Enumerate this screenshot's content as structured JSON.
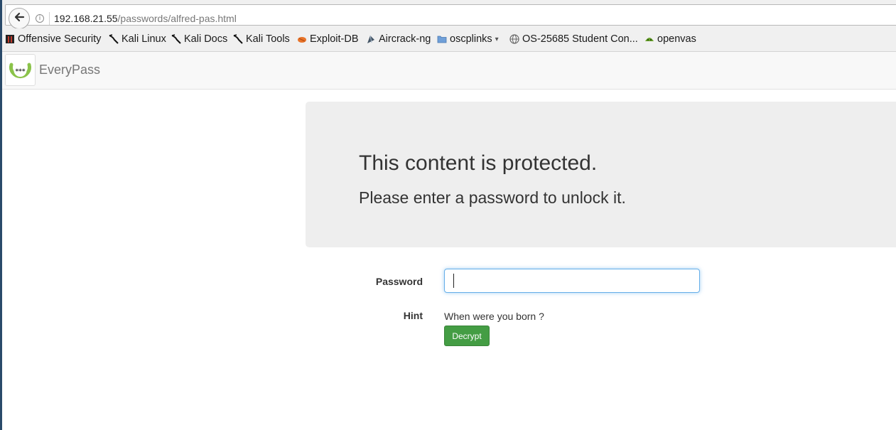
{
  "browser": {
    "url_host": "192.168.21.55",
    "url_path": "/passwords/alfred-pas.html",
    "back_icon": "arrow-left-icon",
    "info_icon": "info-icon"
  },
  "bookmarks": [
    {
      "label": "Offensive Security",
      "icon": "offsec-icon"
    },
    {
      "label": "Kali Linux",
      "icon": "kali-dragon-icon"
    },
    {
      "label": "Kali Docs",
      "icon": "kali-dragon-icon"
    },
    {
      "label": "Kali Tools",
      "icon": "kali-dragon-icon"
    },
    {
      "label": "Exploit-DB",
      "icon": "exploitdb-icon"
    },
    {
      "label": "Aircrack-ng",
      "icon": "aircrack-icon"
    },
    {
      "label": "oscplinks",
      "icon": "folder-icon",
      "dropdown": "▾"
    },
    {
      "label": "OS-25685 Student Con...",
      "icon": "globe-icon"
    },
    {
      "label": "openvas",
      "icon": "openvas-icon"
    }
  ],
  "site": {
    "brand": "EveryPass",
    "logo_text": "***"
  },
  "jumbotron": {
    "title": "This content is protected.",
    "subtitle": "Please enter a password to unlock it."
  },
  "form": {
    "password_label": "Password",
    "password_value": "",
    "hint_label": "Hint",
    "hint_text": "When were you born ?",
    "decrypt_label": "Decrypt"
  },
  "colors": {
    "button_green": "#449d44",
    "focus_blue": "#66afe9",
    "logo_green": "#8bc34a"
  }
}
